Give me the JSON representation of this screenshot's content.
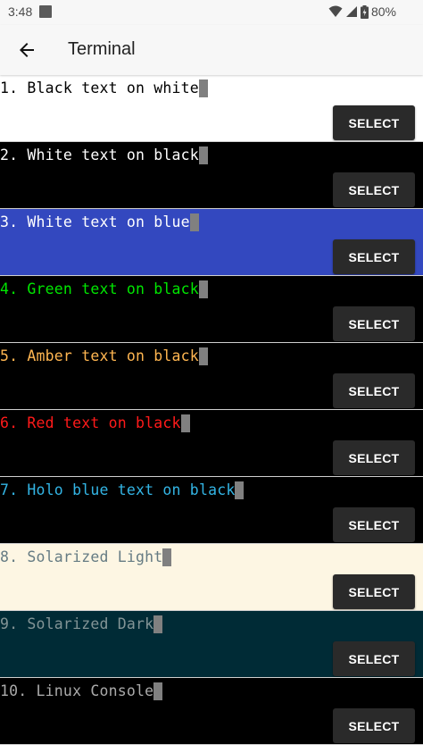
{
  "status_bar": {
    "time": "3:48",
    "battery": "80%",
    "icons": [
      "notification-icon",
      "wifi-icon",
      "signal-icon",
      "battery-icon"
    ]
  },
  "app_bar": {
    "title": "Terminal",
    "back_icon": "arrow-back-icon"
  },
  "themes": [
    {
      "label": "1. Black text on white",
      "fg": "#000000",
      "bg": "#ffffff",
      "button": "SELECT"
    },
    {
      "label": "2. White text on black",
      "fg": "#ffffff",
      "bg": "#000000",
      "button": "SELECT"
    },
    {
      "label": "3. White text on blue",
      "fg": "#ffffff",
      "bg": "#3348bf",
      "button": "SELECT"
    },
    {
      "label": "4. Green text on black",
      "fg": "#00e600",
      "bg": "#000000",
      "button": "SELECT"
    },
    {
      "label": "5. Amber text on black",
      "fg": "#ffb651",
      "bg": "#000000",
      "button": "SELECT"
    },
    {
      "label": "6. Red text on black",
      "fg": "#ff1a1a",
      "bg": "#000000",
      "button": "SELECT"
    },
    {
      "label": "7. Holo blue text on black",
      "fg": "#33b5e5",
      "bg": "#000000",
      "button": "SELECT"
    },
    {
      "label": "8. Solarized Light",
      "fg": "#657b83",
      "bg": "#fdf6e3",
      "button": "SELECT"
    },
    {
      "label": "9. Solarized Dark",
      "fg": "#839496",
      "bg": "#002b36",
      "button": "SELECT"
    },
    {
      "label": "10. Linux Console",
      "fg": "#aaaaaa",
      "bg": "#000000",
      "button": "SELECT"
    }
  ]
}
